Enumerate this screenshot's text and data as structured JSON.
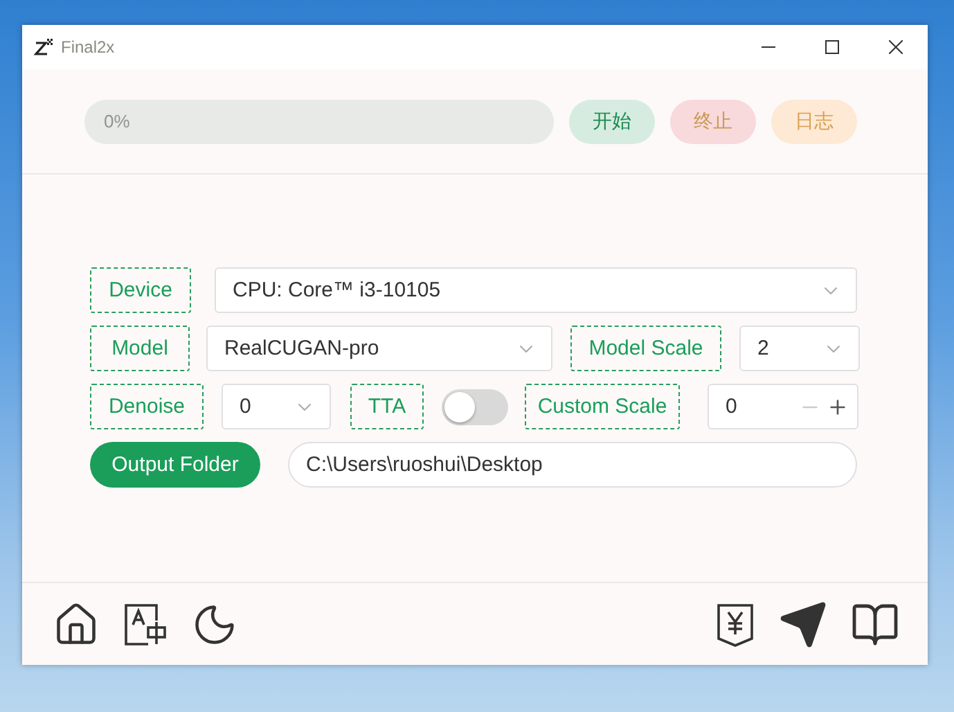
{
  "window": {
    "title": "Final2x"
  },
  "progress": {
    "text": "0%",
    "level": 0
  },
  "actions": [
    {
      "kind": "start",
      "label": "开始"
    },
    {
      "kind": "stop",
      "label": "终止"
    },
    {
      "kind": "log",
      "label": "日志"
    }
  ],
  "settings": [
    [
      {
        "kind": "label",
        "text": "Device"
      },
      {
        "kind": "select",
        "value": "CPU: Core™ i3-10105"
      }
    ],
    [
      {
        "kind": "label",
        "text": "Model"
      },
      {
        "kind": "select",
        "value": "RealCUGAN-pro"
      },
      {
        "kind": "label",
        "text": "Model Scale"
      },
      {
        "kind": "select",
        "value": "2"
      }
    ],
    [
      {
        "kind": "label",
        "text": "Denoise"
      },
      {
        "kind": "select",
        "value": "0"
      },
      {
        "kind": "label",
        "text": "TTA"
      },
      {
        "kind": "toggle",
        "on": false
      },
      {
        "kind": "label",
        "text": "Custom Scale"
      },
      {
        "kind": "spin",
        "value": "0"
      }
    ],
    [
      {
        "kind": "button",
        "text": "Output Folder"
      },
      {
        "kind": "path",
        "value": "C:\\Users\\ruoshui\\Desktop"
      }
    ]
  ]
}
